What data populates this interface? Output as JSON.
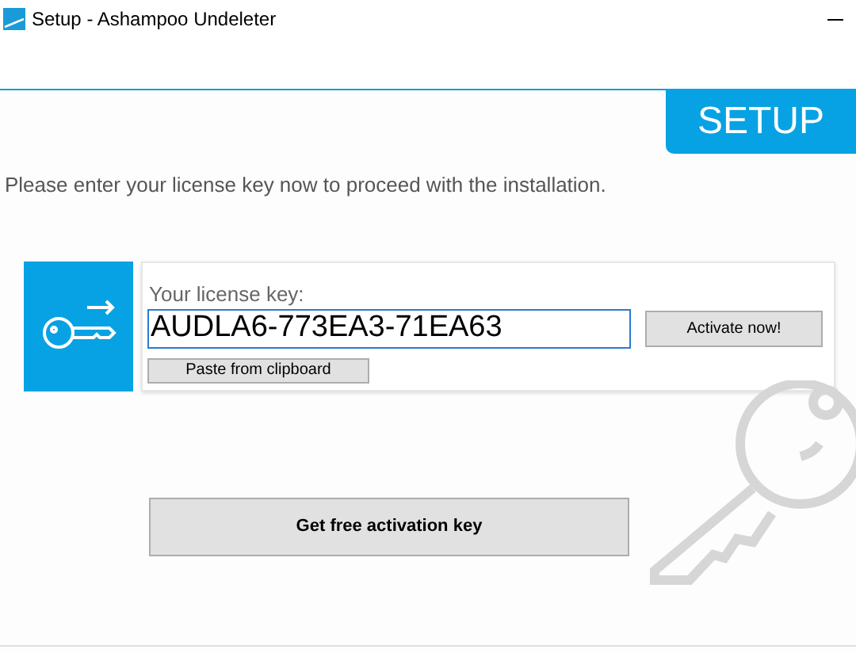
{
  "window": {
    "title": "Setup - Ashampoo Undeleter"
  },
  "header": {
    "badge": "SETUP"
  },
  "instruction": "Please enter your license key now to proceed with the installation.",
  "license": {
    "label": "Your license key:",
    "value": "AUDLA6-773EA3-71EA63",
    "focused": true
  },
  "buttons": {
    "activate": "Activate now!",
    "paste": "Paste from clipboard",
    "free_key": "Get free activation key"
  }
}
